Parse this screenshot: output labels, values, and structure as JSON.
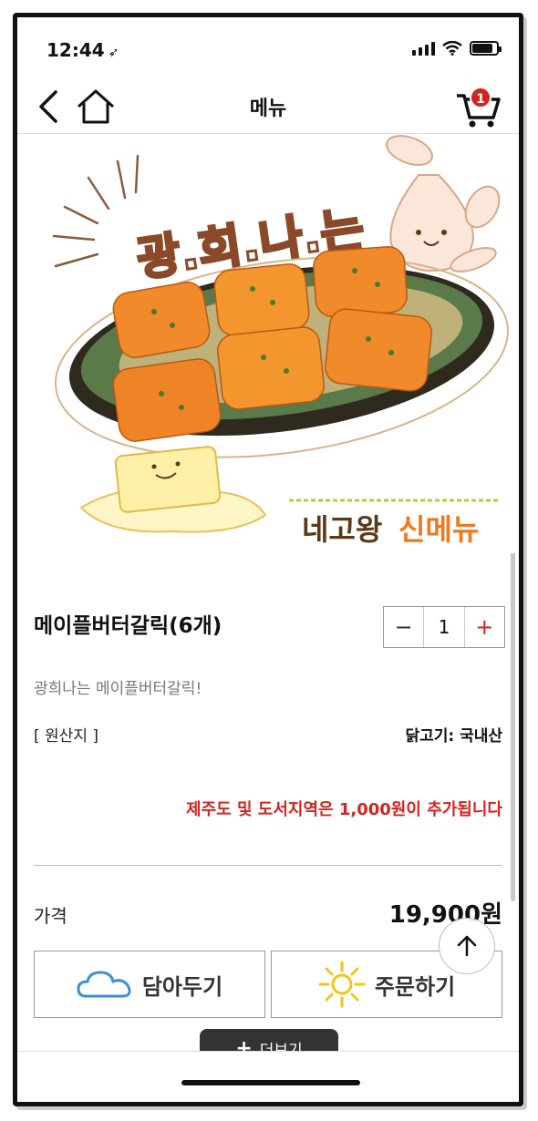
{
  "status": {
    "time": "12:44",
    "battery_level": 0.85
  },
  "nav": {
    "title": "메뉴",
    "cart_count": "1"
  },
  "hero": {
    "headline": "광.희.나.는",
    "tag_part1": "네고왕",
    "tag_part2": "신메뉴"
  },
  "product": {
    "name": "메이플버터갈릭(6개)",
    "quantity": "1",
    "minus": "−",
    "plus": "+",
    "description": "광희나는 메이플버터갈릭!",
    "origin_label": "[ 원산지 ]",
    "origin_value": "닭고기: 국내산",
    "notice": "제주도 및 도서지역은 1,000원이 추가됩니다",
    "price_label": "가격",
    "price_value": "19,900원"
  },
  "actions": {
    "save_label": "담아두기",
    "order_label": "주문하기",
    "more_label": "더보기"
  },
  "colors": {
    "accent": "#d6231f",
    "cloud": "#3b8fd8",
    "sun": "#f3c515"
  }
}
